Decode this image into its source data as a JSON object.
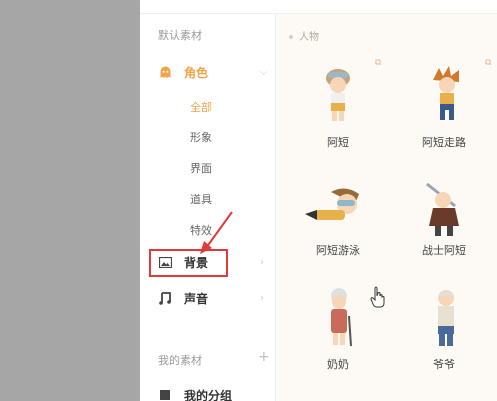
{
  "sidebar": {
    "default_section": "默认素材",
    "role": {
      "label": "角色"
    },
    "sub_items": [
      "全部",
      "形象",
      "界面",
      "道具",
      "特效"
    ],
    "background": {
      "label": "背景"
    },
    "sound": {
      "label": "声音"
    },
    "my_section": "我的素材",
    "my_group": {
      "label": "我的分组"
    }
  },
  "content": {
    "category": "人物",
    "characters": [
      {
        "name": "阿短"
      },
      {
        "name": "阿短走路"
      },
      {
        "name": "阿短游泳"
      },
      {
        "name": "战士阿短"
      },
      {
        "name": "奶奶"
      },
      {
        "name": "爷爷"
      }
    ]
  },
  "colors": {
    "accent": "#f0a54a",
    "highlight_box": "#e23a3a"
  }
}
